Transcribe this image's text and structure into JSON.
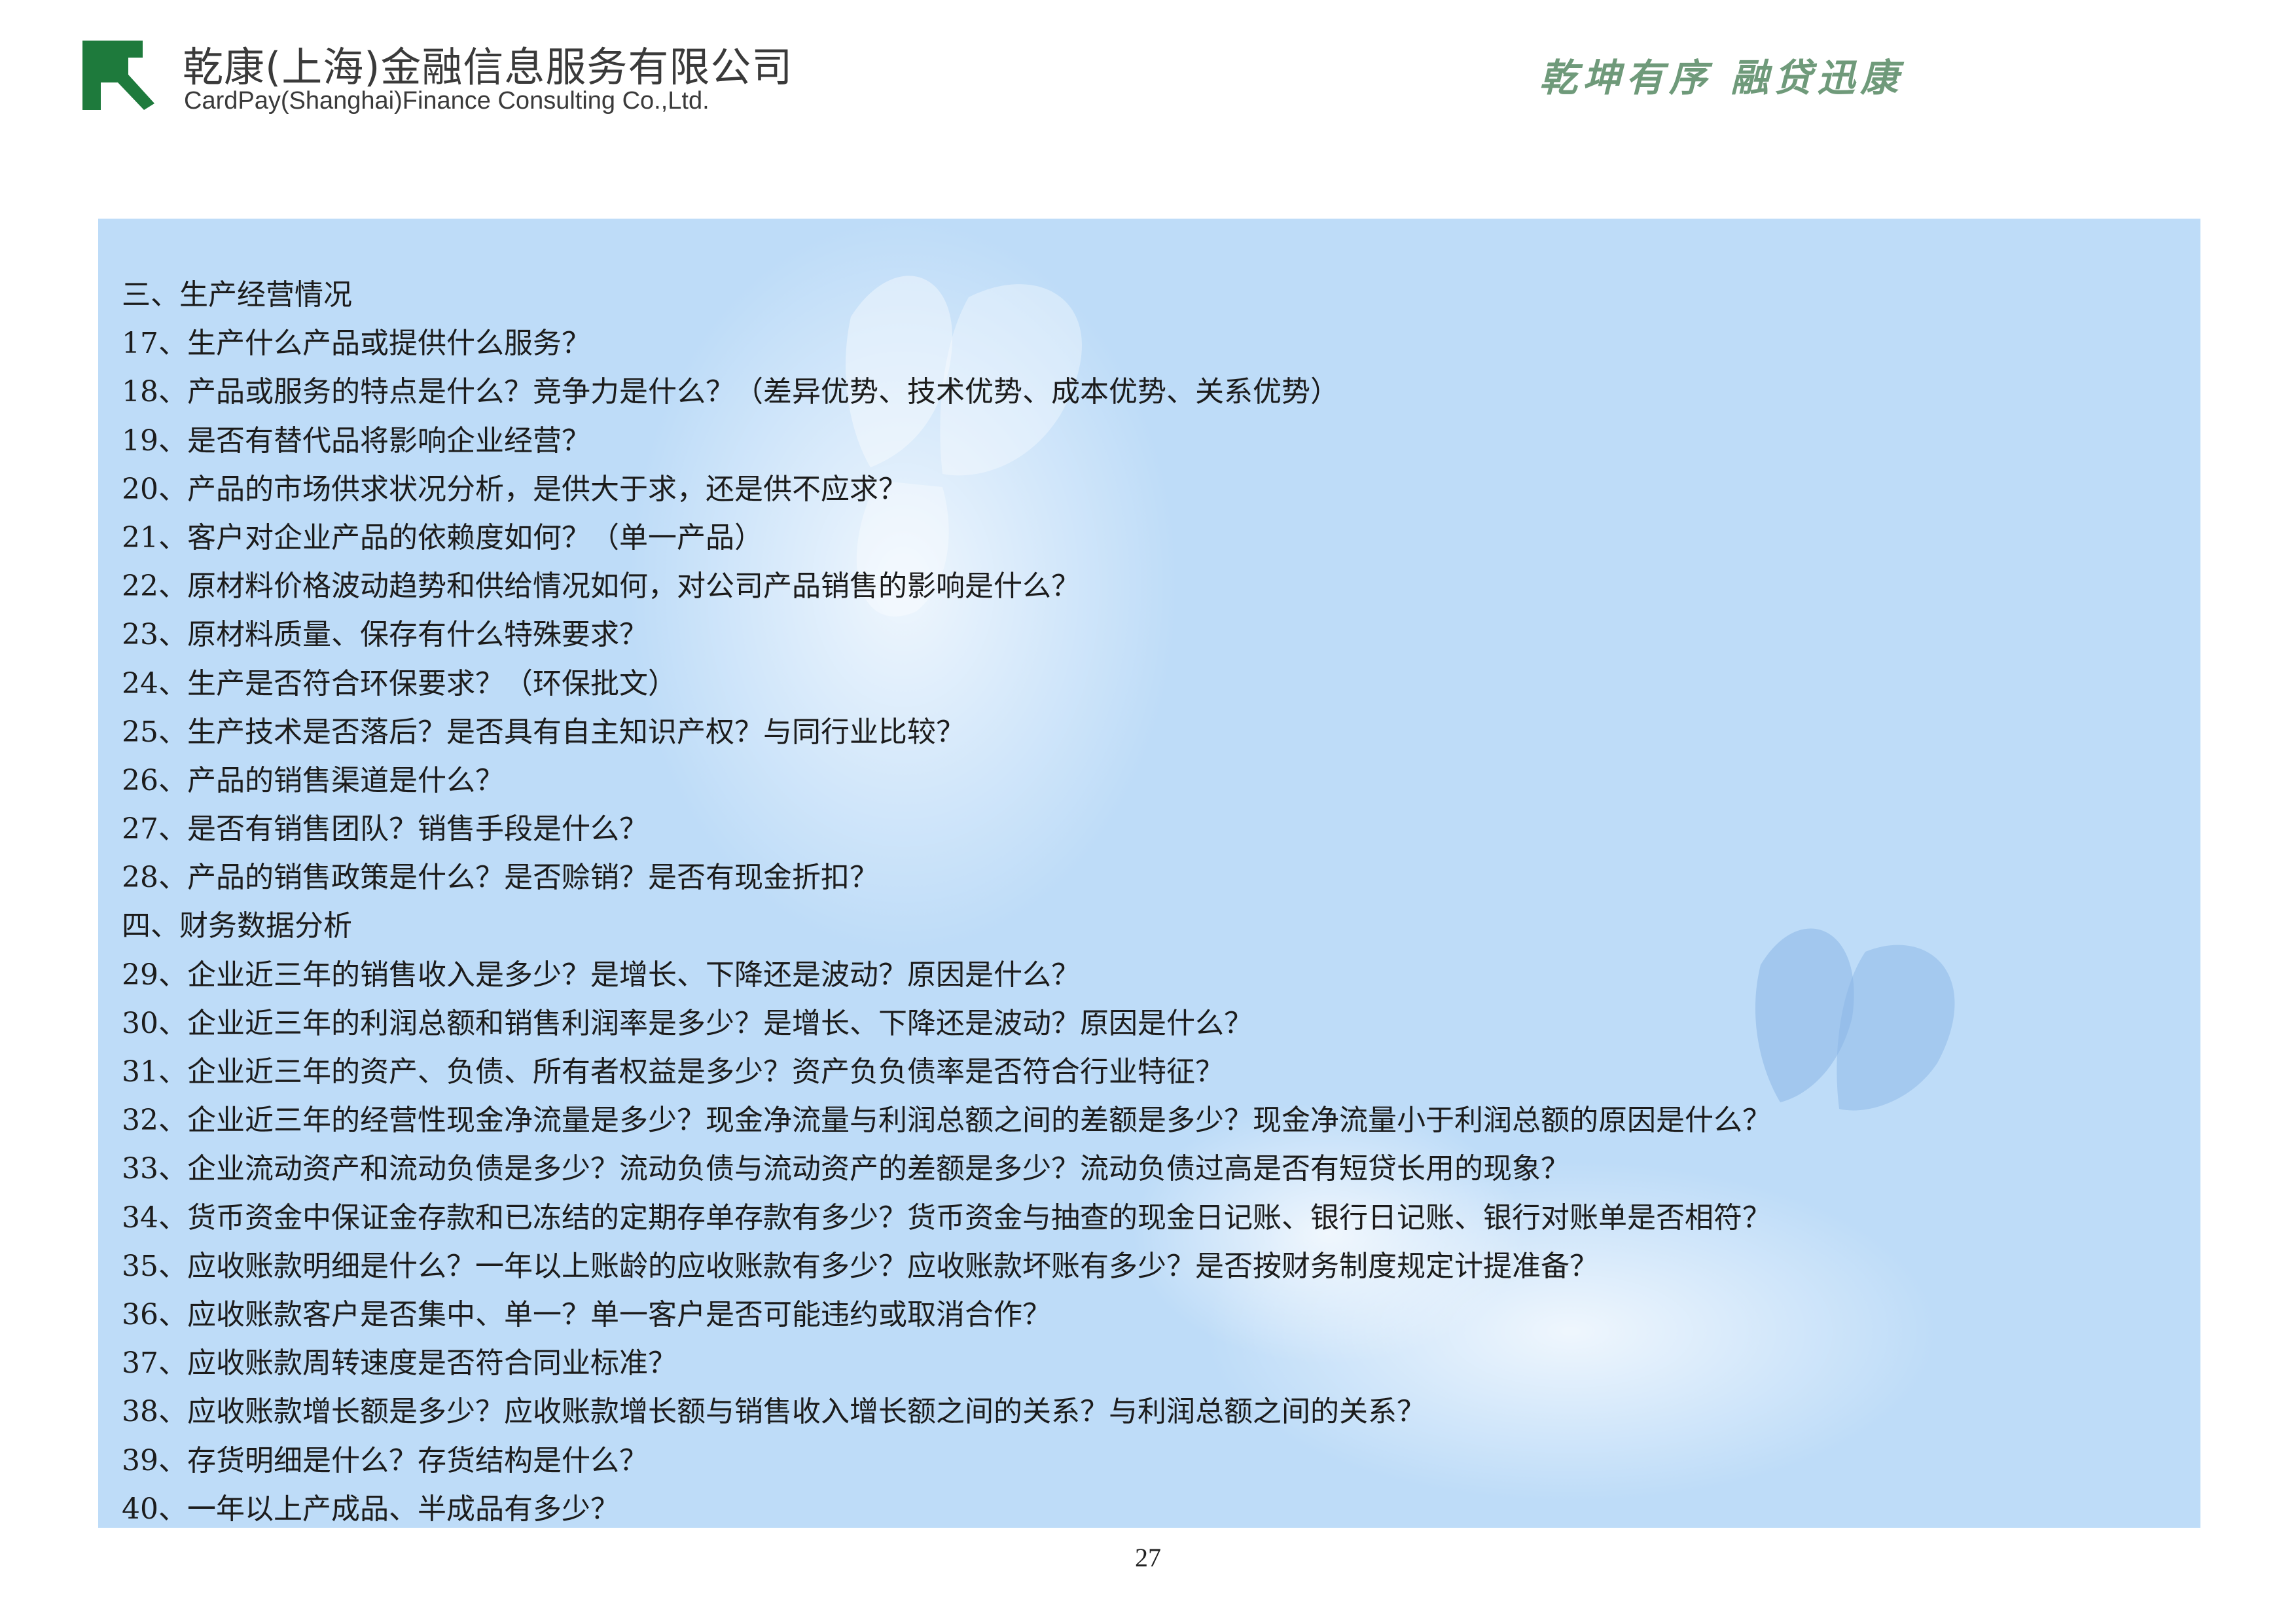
{
  "header": {
    "company_name_cn": "乾康(上海)金融信息服务有限公司",
    "company_name_en": "CardPay(Shanghai)Finance Consulting Co.,Ltd.",
    "slogan": "乾坤有序 融贷迅康",
    "logo_icon": "company-logo-icon",
    "brand_color": "#1e7a3c"
  },
  "content": {
    "background_color": "#bedcf8",
    "lines": [
      "三、生产经营情况",
      "17、生产什么产品或提供什么服务？",
      "18、产品或服务的特点是什么？竞争力是什么？（差异优势、技术优势、成本优势、关系优势）",
      "19、是否有替代品将影响企业经营？",
      "20、产品的市场供求状况分析，是供大于求，还是供不应求？",
      "21、客户对企业产品的依赖度如何？（单一产品）",
      "22、原材料价格波动趋势和供给情况如何，对公司产品销售的影响是什么？",
      "23、原材料质量、保存有什么特殊要求？",
      "24、生产是否符合环保要求？（环保批文）",
      "25、生产技术是否落后？是否具有自主知识产权？与同行业比较？",
      "26、产品的销售渠道是什么？",
      "27、是否有销售团队？销售手段是什么？",
      "28、产品的销售政策是什么？是否赊销？是否有现金折扣？",
      "四、财务数据分析",
      "29、企业近三年的销售收入是多少？是增长、下降还是波动？原因是什么？",
      "30、企业近三年的利润总额和销售利润率是多少？是增长、下降还是波动？原因是什么？",
      "31、企业近三年的资产、负债、所有者权益是多少？资产负负债率是否符合行业特征？",
      "32、企业近三年的经营性现金净流量是多少？现金净流量与利润总额之间的差额是多少？现金净流量小于利润总额的原因是什么？",
      "33、企业流动资产和流动负债是多少？流动负债与流动资产的差额是多少？流动负债过高是否有短贷长用的现象？",
      "34、货币资金中保证金存款和已冻结的定期存单存款有多少？货币资金与抽查的现金日记账、银行日记账、银行对账单是否相符？",
      "35、应收账款明细是什么？一年以上账龄的应收账款有多少？应收账款坏账有多少？是否按财务制度规定计提准备？",
      "36、应收账款客户是否集中、单一？单一客户是否可能违约或取消合作？",
      "37、应收账款周转速度是否符合同业标准？",
      "38、应收账款增长额是多少？应收账款增长额与销售收入增长额之间的关系？与利润总额之间的关系？",
      "39、存货明细是什么？存货结构是什么？",
      "40、一年以上产成品、半成品有多少？"
    ]
  },
  "footer": {
    "page_number": "27"
  }
}
